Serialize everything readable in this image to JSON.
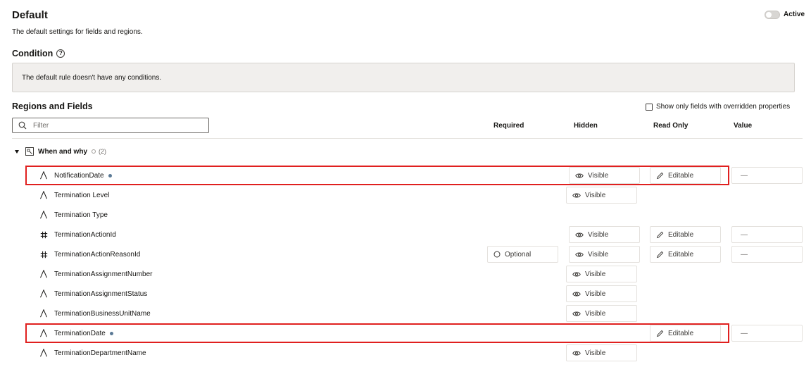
{
  "header": {
    "title": "Default",
    "subtitle": "The default settings for fields and regions.",
    "toggle_label": "Active"
  },
  "condition": {
    "title": "Condition",
    "text": "The default rule doesn't have any conditions."
  },
  "regions": {
    "title": "Regions and Fields",
    "show_overridden_label": "Show only fields with overridden properties",
    "filter_placeholder": "Filter",
    "columns": {
      "required": "Required",
      "hidden": "Hidden",
      "read_only": "Read Only",
      "value": "Value"
    },
    "group": {
      "name": "When and why",
      "count": "(2)"
    }
  },
  "rows": [
    {
      "icon": "text-field-icon",
      "name": "NotificationDate",
      "modified": true,
      "required": null,
      "hidden": "Visible",
      "read_only": "Editable",
      "value": "—",
      "highlighted": true
    },
    {
      "icon": "text-field-icon",
      "name": "Termination Level",
      "modified": false,
      "required": null,
      "hidden": "Visible",
      "read_only": null,
      "value": null,
      "highlighted": false
    },
    {
      "icon": "text-field-icon",
      "name": "Termination Type",
      "modified": false,
      "required": null,
      "hidden": null,
      "read_only": null,
      "value": null,
      "highlighted": false
    },
    {
      "icon": "number-field-icon",
      "name": "TerminationActionId",
      "modified": false,
      "required": null,
      "hidden": "Visible",
      "read_only": "Editable",
      "value": "—",
      "highlighted": false
    },
    {
      "icon": "number-field-icon",
      "name": "TerminationActionReasonId",
      "modified": false,
      "required": "Optional",
      "hidden": "Visible",
      "read_only": "Editable",
      "value": "—",
      "highlighted": false
    },
    {
      "icon": "text-field-icon",
      "name": "TerminationAssignmentNumber",
      "modified": false,
      "required": null,
      "hidden": "Visible",
      "read_only": null,
      "value": null,
      "highlighted": false
    },
    {
      "icon": "text-field-icon",
      "name": "TerminationAssignmentStatus",
      "modified": false,
      "required": null,
      "hidden": "Visible",
      "read_only": null,
      "value": null,
      "highlighted": false
    },
    {
      "icon": "text-field-icon",
      "name": "TerminationBusinessUnitName",
      "modified": false,
      "required": null,
      "hidden": "Visible",
      "read_only": null,
      "value": null,
      "highlighted": false
    },
    {
      "icon": "text-field-icon",
      "name": "TerminationDate",
      "modified": true,
      "required": null,
      "hidden": null,
      "read_only": "Editable",
      "value": "—",
      "highlighted": true
    },
    {
      "icon": "text-field-icon",
      "name": "TerminationDepartmentName",
      "modified": false,
      "required": null,
      "hidden": "Visible",
      "read_only": null,
      "value": null,
      "highlighted": false
    }
  ],
  "colors": {
    "highlight": "#e0201f",
    "modified_dot": "#5b7a96",
    "condition_bg": "#f1efed"
  }
}
